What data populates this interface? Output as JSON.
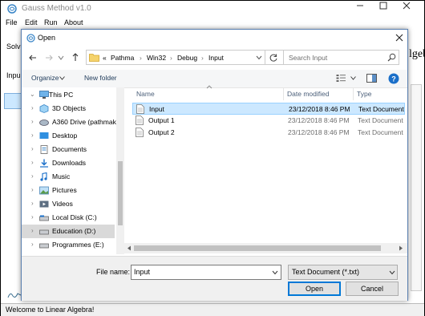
{
  "app": {
    "title": "Gauss Method v1.0",
    "menu": [
      "File",
      "Edit",
      "Run",
      "About"
    ],
    "status": "Welcome to Linear Algebra!",
    "side_partial_a": "Solv",
    "side_partial_b": "Inpu",
    "right_partial": "lgebra"
  },
  "dialog": {
    "title": "Open",
    "path": [
      "Pathma",
      "Win32",
      "Debug",
      "Input"
    ],
    "path_prefix": "«",
    "search_placeholder": "Search Input",
    "toolbar": {
      "organize": "Organize",
      "new_folder": "New folder"
    },
    "nav": [
      {
        "label": "This PC",
        "icon": "pc-icon"
      },
      {
        "label": "3D Objects",
        "icon": "cube-icon"
      },
      {
        "label": "A360 Drive (pathmak",
        "icon": "cloud-drive-icon"
      },
      {
        "label": "Desktop",
        "icon": "desktop-icon"
      },
      {
        "label": "Documents",
        "icon": "documents-icon"
      },
      {
        "label": "Downloads",
        "icon": "downloads-icon"
      },
      {
        "label": "Music",
        "icon": "music-icon"
      },
      {
        "label": "Pictures",
        "icon": "pictures-icon"
      },
      {
        "label": "Videos",
        "icon": "videos-icon"
      },
      {
        "label": "Local Disk (C:)",
        "icon": "disk-icon"
      },
      {
        "label": "Education (D:)",
        "icon": "disk-icon"
      },
      {
        "label": "Programmes (E:)",
        "icon": "disk-icon"
      }
    ],
    "columns": {
      "name": "Name",
      "date": "Date modified",
      "type": "Type"
    },
    "files": [
      {
        "name": "Input",
        "date": "23/12/2018 8:46 PM",
        "type": "Text Document"
      },
      {
        "name": "Output 1",
        "date": "23/12/2018 8:46 PM",
        "type": "Text Document"
      },
      {
        "name": "Output 2",
        "date": "23/12/2018 8:46 PM",
        "type": "Text Document"
      }
    ],
    "filename_label": "File name:",
    "filename_value": "Input",
    "filetype_value": "Text Document (*.txt)",
    "open_label": "Open",
    "cancel_label": "Cancel"
  },
  "colors": {
    "accent": "#0078d7",
    "selected": "#cce8ff",
    "nav_selected": "#d9d9d9"
  }
}
